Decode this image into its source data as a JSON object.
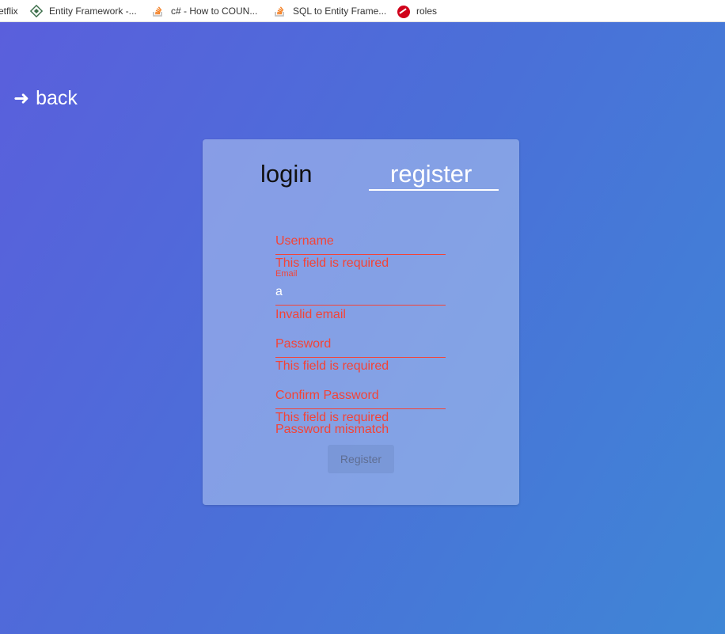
{
  "bookmarks": [
    {
      "label": "etflix",
      "icon": "netflix-icon"
    },
    {
      "label": "Entity Framework -...",
      "icon": "entity-framework-icon"
    },
    {
      "label": "c# - How to COUN...",
      "icon": "stackoverflow-icon"
    },
    {
      "label": "SQL to Entity Frame...",
      "icon": "stackoverflow-icon"
    },
    {
      "label": "roles",
      "icon": "roles-icon"
    }
  ],
  "back": {
    "arrow": "➜",
    "label": "back"
  },
  "tabs": {
    "login": "login",
    "register": "register",
    "active": "register"
  },
  "form": {
    "username": {
      "label": "Username",
      "error": "This field is required"
    },
    "email": {
      "label": "Email",
      "value": "a",
      "error": "Invalid email"
    },
    "password": {
      "label": "Password",
      "error": "This field is required"
    },
    "confirm": {
      "label": "Confirm Password",
      "error": "This field is required",
      "error2": "Password mismatch"
    },
    "submit": "Register"
  },
  "colors": {
    "error": "#f44336",
    "gradient_start": "#5a5fdc",
    "gradient_end": "#3f86d6"
  }
}
